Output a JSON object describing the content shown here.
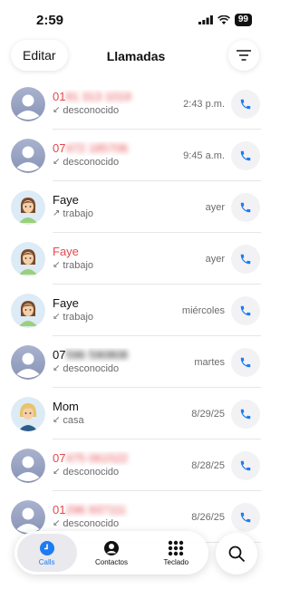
{
  "status": {
    "time": "2:59",
    "battery": "99"
  },
  "header": {
    "edit_label": "Editar",
    "title": "Llamadas"
  },
  "calls": [
    {
      "name": "0191 313 1019",
      "type": "desconocido",
      "time": "2:43 p.m.",
      "missed": true,
      "avatar": "generic",
      "dir": "in"
    },
    {
      "name": "07472 185706",
      "type": "desconocido",
      "time": "9:45 a.m.",
      "missed": true,
      "avatar": "generic",
      "dir": "in"
    },
    {
      "name": "Faye",
      "type": "trabajo",
      "time": "ayer",
      "missed": false,
      "avatar": "faye",
      "dir": "out"
    },
    {
      "name": "Faye",
      "type": "trabajo",
      "time": "ayer",
      "missed": true,
      "avatar": "faye",
      "dir": "in"
    },
    {
      "name": "Faye",
      "type": "trabajo",
      "time": "miércoles",
      "missed": false,
      "avatar": "faye",
      "dir": "in"
    },
    {
      "name": "07596 590808",
      "type": "desconocido",
      "time": "martes",
      "missed": false,
      "avatar": "generic",
      "dir": "in"
    },
    {
      "name": "Mom",
      "type": "casa",
      "time": "8/29/25",
      "missed": false,
      "avatar": "mom",
      "dir": "in"
    },
    {
      "name": "07475 061522",
      "type": "desconocido",
      "time": "8/28/25",
      "missed": true,
      "avatar": "generic",
      "dir": "in"
    },
    {
      "name": "01296 937111",
      "type": "desconocido",
      "time": "8/26/25",
      "missed": true,
      "avatar": "generic",
      "dir": "in"
    }
  ],
  "tabs": [
    {
      "label": "Calls",
      "icon": "clock-icon",
      "active": true
    },
    {
      "label": "Contactos",
      "icon": "person-icon",
      "active": false
    },
    {
      "label": "Teclado",
      "icon": "keypad-icon",
      "active": false
    }
  ],
  "colors": {
    "accent": "#1e7cf2",
    "missed": "#e5484d"
  }
}
